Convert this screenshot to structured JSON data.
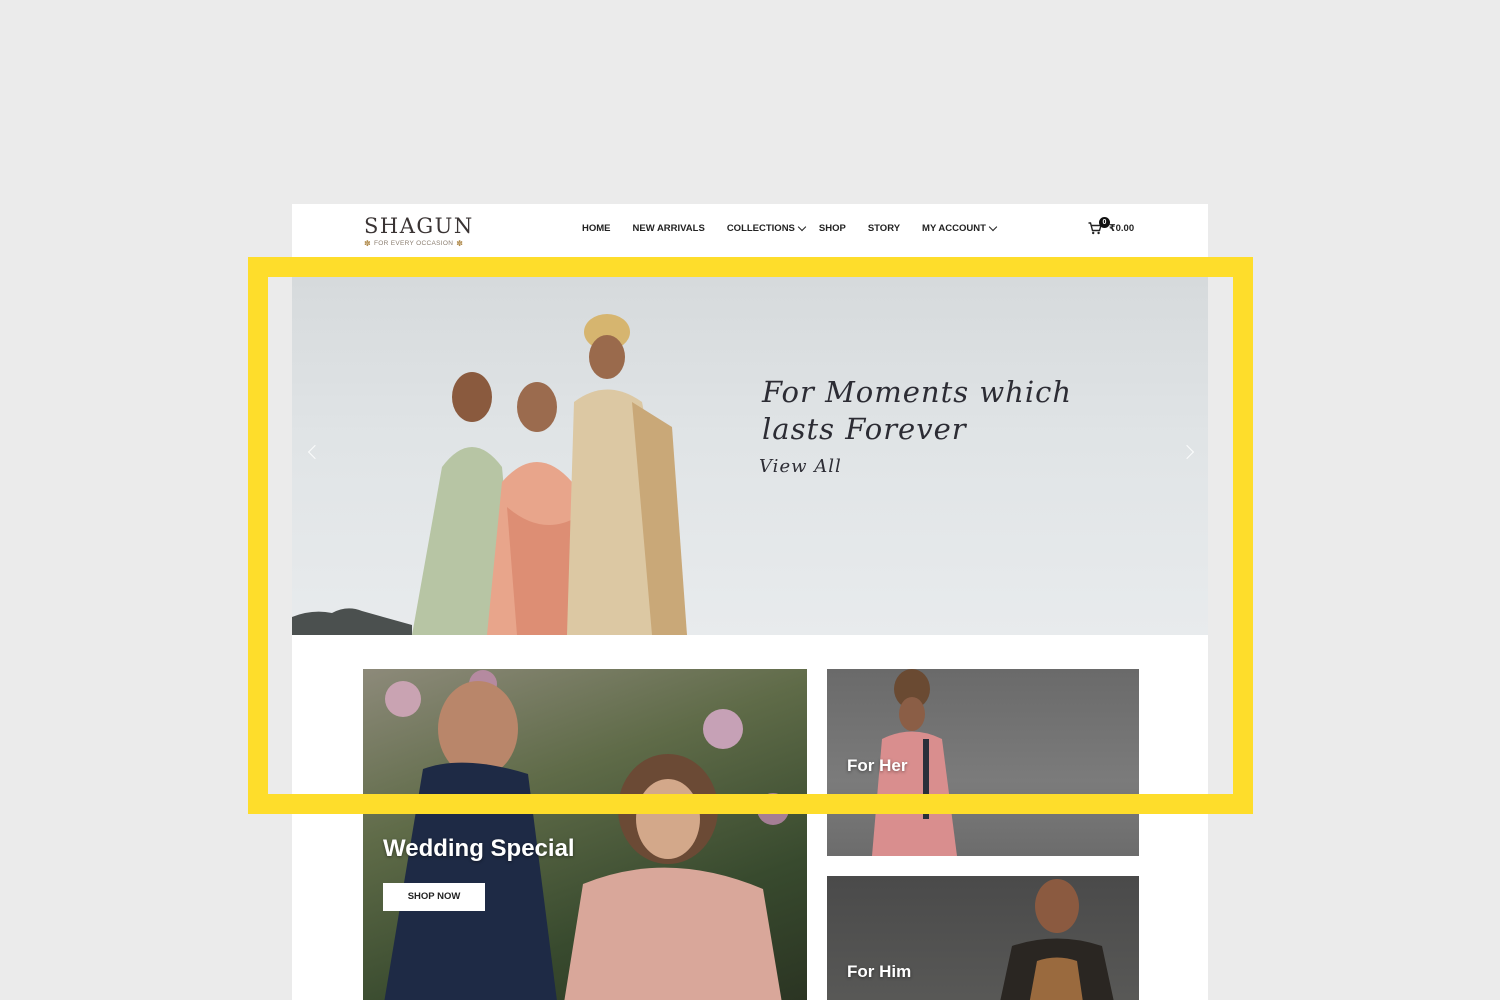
{
  "brand": {
    "name": "SHAGUN",
    "tagline": "FOR EVERY OCCASION"
  },
  "nav": {
    "items": [
      {
        "label": "HOME",
        "has_dropdown": false
      },
      {
        "label": "NEW ARRIVALS",
        "has_dropdown": false
      },
      {
        "label": "COLLECTIONS",
        "has_dropdown": true
      },
      {
        "label": "SHOP",
        "has_dropdown": false
      },
      {
        "label": "STORY",
        "has_dropdown": false
      },
      {
        "label": "MY ACCOUNT",
        "has_dropdown": true
      }
    ]
  },
  "cart": {
    "count": "0",
    "total": "₹0.00",
    "icon": "cart-icon"
  },
  "hero": {
    "headline_line1": "For Moments which",
    "headline_line2": "lasts Forever",
    "link": "View All"
  },
  "banners": {
    "wedding": {
      "title": "Wedding Special",
      "button": "SHOP NOW"
    },
    "her": {
      "title": "For Her"
    },
    "him": {
      "title": "For Him"
    }
  },
  "colors": {
    "highlight": "#fedd2b",
    "page_bg": "#ebebeb",
    "text_dark": "#2c2c34"
  }
}
